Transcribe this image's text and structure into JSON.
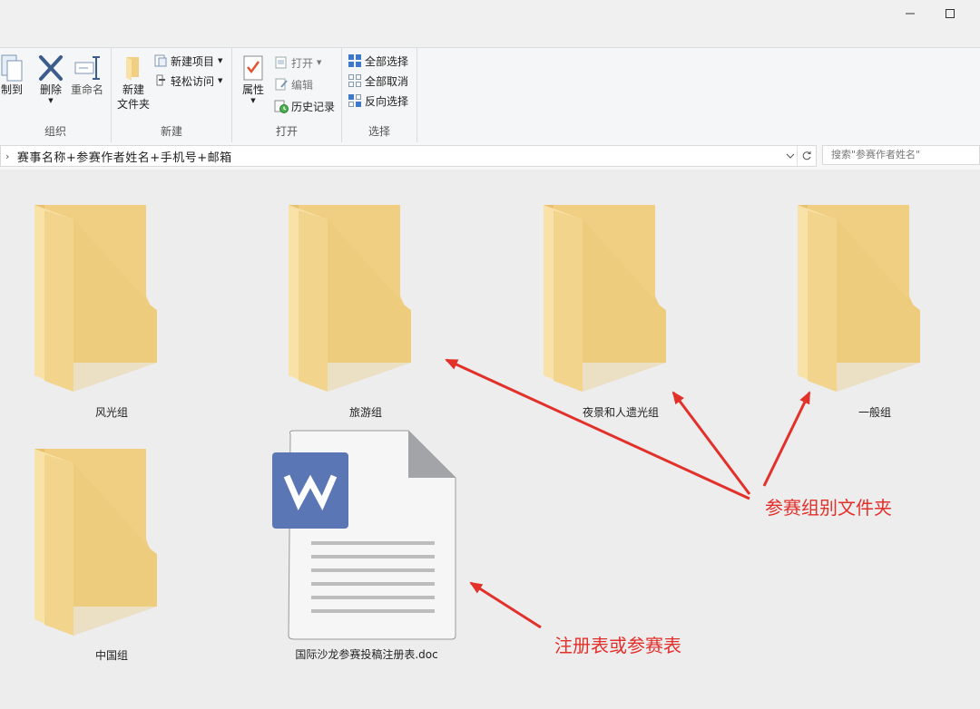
{
  "ribbon": {
    "organize": {
      "label": "组织",
      "copy_to": "制到",
      "delete": "删除",
      "rename": "重命名"
    },
    "new": {
      "label": "新建",
      "new_folder_line1": "新建",
      "new_folder_line2": "文件夹",
      "new_item": "新建项目",
      "easy_access": "轻松访问"
    },
    "open": {
      "label": "打开",
      "properties": "属性",
      "open": "打开",
      "edit": "编辑",
      "history": "历史记录"
    },
    "select": {
      "label": "选择",
      "select_all": "全部选择",
      "select_none": "全部取消",
      "invert": "反向选择"
    }
  },
  "address": {
    "path": "赛事名称+参赛作者姓名+手机号+邮箱",
    "search_placeholder": "搜索\"参赛作者姓名\""
  },
  "items": [
    {
      "name": "风光组",
      "type": "folder"
    },
    {
      "name": "旅游组",
      "type": "folder"
    },
    {
      "name": "夜景和人遗光组",
      "type": "folder"
    },
    {
      "name": "一般组",
      "type": "folder"
    },
    {
      "name": "中国组",
      "type": "folder"
    },
    {
      "name": "国际沙龙参赛投稿注册表.doc",
      "type": "wps-doc"
    }
  ],
  "annotations": {
    "folders": "参赛组别文件夹",
    "register": "注册表或参赛表",
    "color": "#e2302b"
  }
}
